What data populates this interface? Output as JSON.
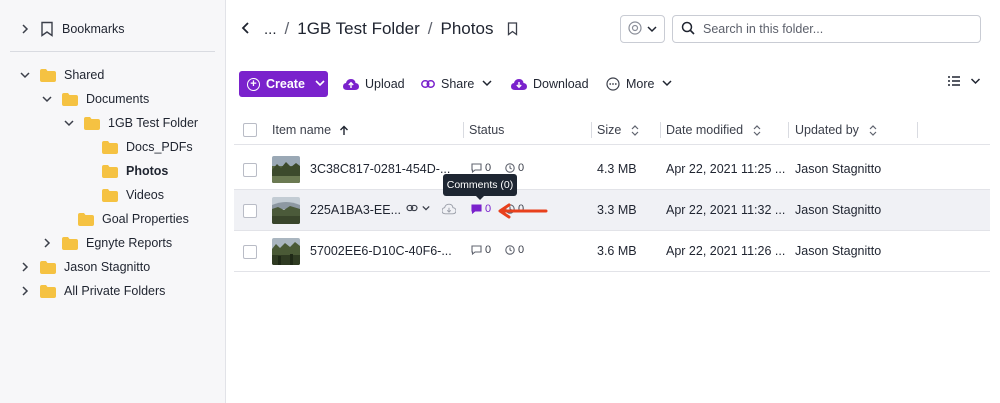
{
  "sidebar": {
    "bookmarks": "Bookmarks",
    "tree": [
      {
        "label": "Shared"
      },
      {
        "label": "Documents"
      },
      {
        "label": "1GB Test Folder"
      },
      {
        "label": "Docs_PDFs"
      },
      {
        "label": "Photos"
      },
      {
        "label": "Videos"
      },
      {
        "label": "Goal Properties"
      },
      {
        "label": "Egnyte Reports"
      },
      {
        "label": "Jason Stagnitto"
      },
      {
        "label": "All Private Folders"
      }
    ]
  },
  "header": {
    "ellipsis": "...",
    "parent": "1GB Test Folder",
    "current": "Photos",
    "search_placeholder": "Search in this folder..."
  },
  "toolbar": {
    "create": "Create",
    "upload": "Upload",
    "share": "Share",
    "download": "Download",
    "more": "More"
  },
  "table": {
    "headers": {
      "name": "Item name",
      "status": "Status",
      "size": "Size",
      "modified": "Date modified",
      "updated_by": "Updated by"
    },
    "rows": [
      {
        "name": "3C38C817-0281-454D-...",
        "comments": "0",
        "versions": "0",
        "size": "4.3 MB",
        "modified": "Apr 22, 2021 11:25 ...",
        "updated_by": "Jason Stagnitto"
      },
      {
        "name": "225A1BA3-EE...",
        "comments": "0",
        "versions": "0",
        "size": "3.3 MB",
        "modified": "Apr 22, 2021 11:32 ...",
        "updated_by": "Jason Stagnitto"
      },
      {
        "name": "57002EE6-D10C-40F6-...",
        "comments": "0",
        "versions": "0",
        "size": "3.6 MB",
        "modified": "Apr 22, 2021 11:26 ...",
        "updated_by": "Jason Stagnitto"
      }
    ]
  },
  "tooltip": "Comments (0)",
  "colors": {
    "accent": "#7a22cc",
    "arrow": "#e8401c",
    "folder": "#f5c242"
  }
}
